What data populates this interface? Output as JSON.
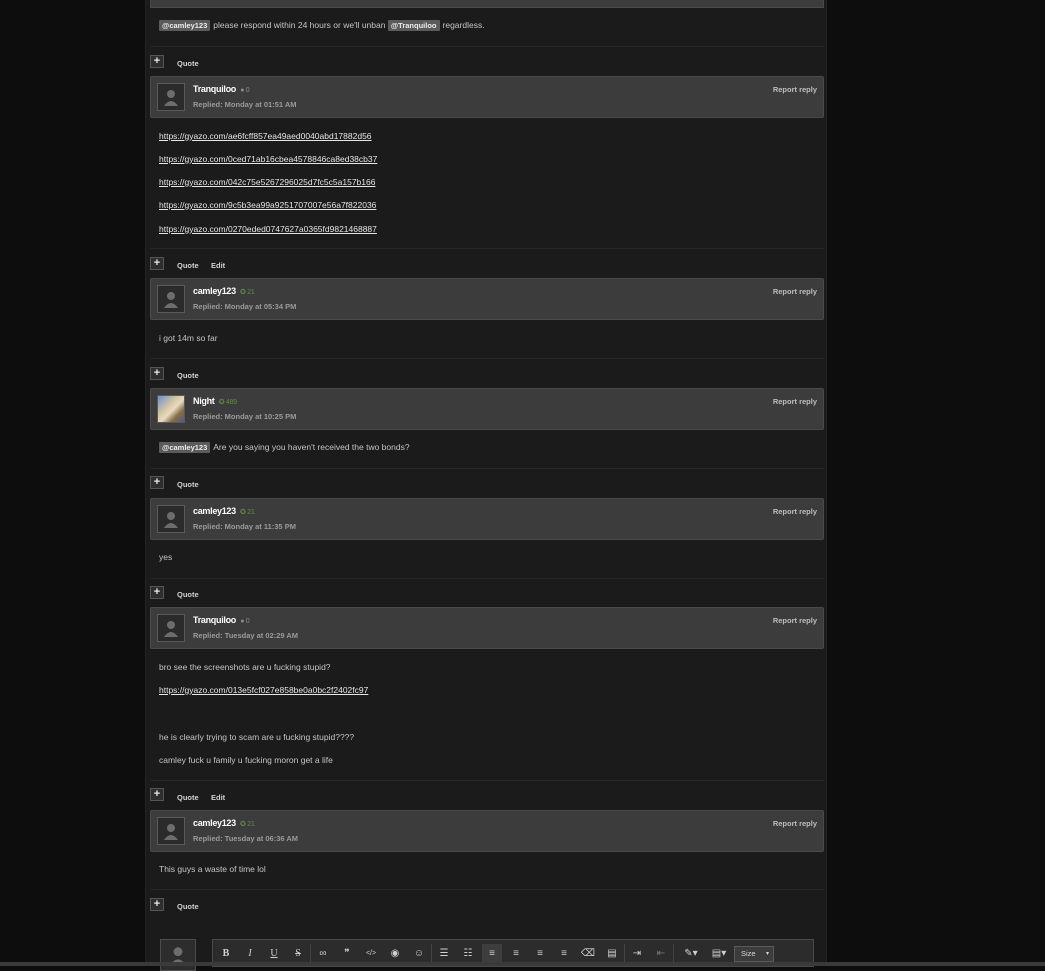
{
  "top_post": {
    "mention1": "@camley123",
    "text1": "please respond within 24 hours or we'll unban",
    "mention2": "@Tranquiloo",
    "text2": "regardless.",
    "actions": {
      "quote": "Quote"
    }
  },
  "posts": [
    {
      "username": "Tranquiloo",
      "rep": "0",
      "date": "Replied: Monday at 01:51 AM",
      "report": "Report reply",
      "links": [
        "https://gyazo.com/ae6fcff857ea49aed0040abd17882d56",
        "https://gyazo.com/0ced71ab16cbea4578846ca8ed38cb37",
        "https://gyazo.com/042c75e5267296025d7fc5c5a157b166",
        "https://gyazo.com/9c5b3ea99a9251707007e56a7f822036",
        "https://gyazo.com/0270eded0747627a0365fd9821468887"
      ],
      "actions": {
        "quote": "Quote",
        "edit": "Edit"
      }
    },
    {
      "username": "camley123",
      "rep": "21",
      "date": "Replied: Monday at 05:34 PM",
      "report": "Report reply",
      "text": "i got 14m so far",
      "actions": {
        "quote": "Quote"
      }
    },
    {
      "username": "Night",
      "rep": "489",
      "date": "Replied: Monday at 10:25 PM",
      "report": "Report reply",
      "mention": "@camley123",
      "text": "Are you saying you haven't received the two bonds?",
      "actions": {
        "quote": "Quote"
      }
    },
    {
      "username": "camley123",
      "rep": "21",
      "date": "Replied: Monday at 11:35 PM",
      "report": "Report reply",
      "text": "yes",
      "actions": {
        "quote": "Quote"
      }
    },
    {
      "username": "Tranquiloo",
      "rep": "0",
      "date": "Replied: Tuesday at 02:29 AM",
      "report": "Report reply",
      "line1": "bro see the screenshots are u fucking stupid?",
      "link": "https://gyazo.com/013e5fcf027e858be0a0bc2f2402fc97",
      "line2": "he is clearly trying to scam are u fucking stupid????",
      "line3": "camley fuck u family u fucking moron get a life",
      "actions": {
        "quote": "Quote",
        "edit": "Edit"
      }
    },
    {
      "username": "camley123",
      "rep": "21",
      "date": "Replied: Tuesday at 06:36 AM",
      "report": "Report reply",
      "text": "This guys a waste of time lol",
      "actions": {
        "quote": "Quote"
      }
    }
  ],
  "plus_label": "+",
  "editor": {
    "size_label": "Size",
    "tools": [
      "bold",
      "italic",
      "underline",
      "strikethrough",
      "link",
      "quote",
      "code",
      "spoiler",
      "emoji",
      "bullet-list",
      "numbered-list",
      "align-left",
      "align-center",
      "align-right",
      "justify",
      "remove-format",
      "source",
      "indent",
      "outdent",
      "color",
      "template"
    ],
    "tool_glyphs": {
      "bold": "B",
      "italic": "I",
      "underline": "U",
      "strikethrough": "S",
      "link": "∞",
      "quote": "❞",
      "code": "</>",
      "spoiler": "◉",
      "emoji": "☺",
      "bullet-list": "☰",
      "numbered-list": "☷",
      "align-left": "≡",
      "align-center": "≡",
      "align-right": "≡",
      "justify": "≡",
      "remove-format": "⌫",
      "source": "▤",
      "indent": "⇥",
      "outdent": "⇤",
      "color": "✎▾",
      "template": "▤▾"
    }
  },
  "colors": {
    "page_bg": "#0d0d0d",
    "column_bg": "#1b1b1b",
    "header_bg": "#3c3c3c",
    "rep_green": "#5f8f3e",
    "rep_gray": "#8c8c8c"
  }
}
